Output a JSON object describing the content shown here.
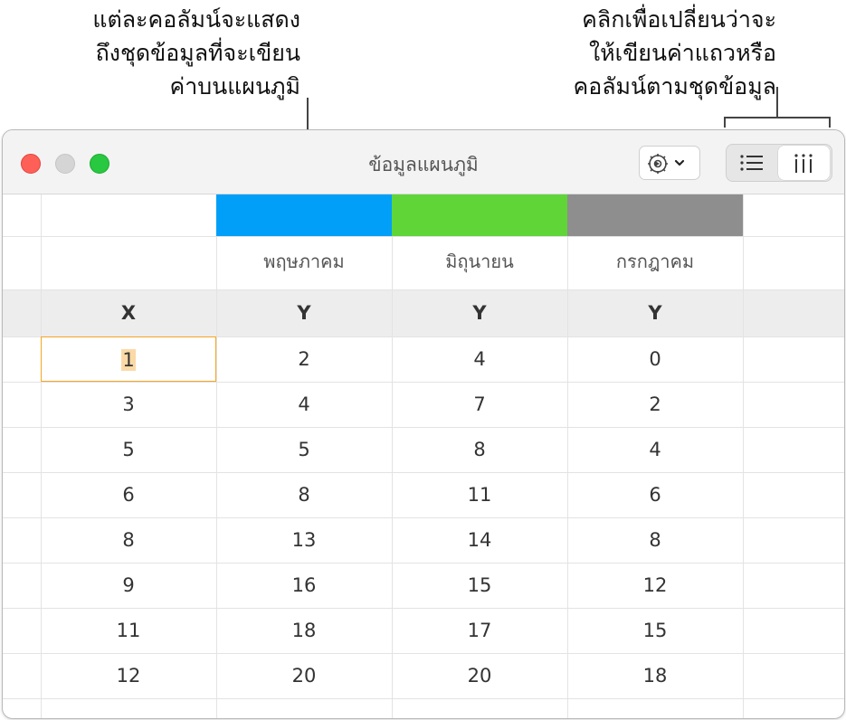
{
  "callouts": {
    "left": [
      "แต่ละคอลัมน์จะแสดง",
      "ถึงชุดข้อมูลที่จะเขียน",
      "ค่าบนแผนภูมิ"
    ],
    "right": [
      "คลิกเพื่อเปลี่ยนว่าจะ",
      "ให้เขียนค่าแถวหรือ",
      "คอลัมน์ตามชุดข้อมูล"
    ]
  },
  "window": {
    "title": "ข้อมูลแผนภูมิ",
    "toolbar": {
      "gear_icon": "gear-with-chevron",
      "rows_icon": "list-rows-icon",
      "columns_icon": "columns-icon",
      "selected_mode": "columns"
    }
  },
  "table": {
    "series": [
      {
        "name": "พฤษภาคม",
        "color": "#019ff8",
        "axis": "Y"
      },
      {
        "name": "มิถุนายน",
        "color": "#5fd538",
        "axis": "Y"
      },
      {
        "name": "กรกฎาคม",
        "color": "#8e8e8e",
        "axis": "Y"
      }
    ],
    "x_label": "X",
    "rows": [
      [
        "1",
        "2",
        "4",
        "0"
      ],
      [
        "3",
        "4",
        "7",
        "2"
      ],
      [
        "5",
        "5",
        "8",
        "4"
      ],
      [
        "6",
        "8",
        "11",
        "6"
      ],
      [
        "8",
        "13",
        "14",
        "8"
      ],
      [
        "9",
        "16",
        "15",
        "12"
      ],
      [
        "11",
        "18",
        "17",
        "15"
      ],
      [
        "12",
        "20",
        "20",
        "18"
      ]
    ],
    "selected_cell": "1"
  }
}
